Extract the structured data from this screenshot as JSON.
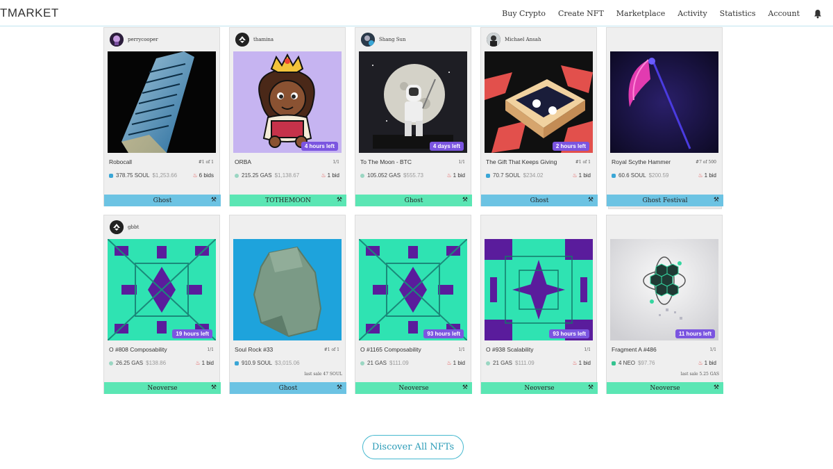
{
  "header": {
    "logo": "TMARKET",
    "nav": [
      "Buy Crypto",
      "Create NFT",
      "Marketplace",
      "Activity",
      "Statistics",
      "Account"
    ]
  },
  "colors": {
    "accent": "#45b8cf",
    "tag_ghost": "#6cc3e3",
    "tag_green": "#5be6b4",
    "badge": "#7b55e0",
    "soul": "#3aa6d6",
    "gas": "#9ad6c2",
    "neo": "#34c38f"
  },
  "cards": [
    {
      "owner": "perrycooper",
      "name": "Robocall",
      "edition": "#1 of 1",
      "price": "378.75 SOUL",
      "usd": "$1,253.66",
      "bids": "6 bids",
      "time_left": "",
      "last_sale": "",
      "tag": "Ghost",
      "currency": "soul"
    },
    {
      "owner": "thamina",
      "name": "ORBA",
      "edition": "1/1",
      "price": "215.25 GAS",
      "usd": "$1,138.67",
      "bids": "1 bid",
      "time_left": "4 hours left",
      "last_sale": "",
      "tag": "TOTHEMOON",
      "currency": "gas"
    },
    {
      "owner": "Shang Sun",
      "name": "To The Moon - BTC",
      "edition": "1/1",
      "price": "105.052 GAS",
      "usd": "$555.73",
      "bids": "1 bid",
      "time_left": "4 days left",
      "last_sale": "",
      "tag": "Ghost",
      "currency": "gas"
    },
    {
      "owner": "Michael Ansah",
      "name": "The Gift That Keeps Giving",
      "edition": "#1 of 1",
      "price": "70.7 SOUL",
      "usd": "$234.02",
      "bids": "1 bid",
      "time_left": "2 hours left",
      "last_sale": "",
      "tag": "Ghost",
      "currency": "soul"
    },
    {
      "owner": "",
      "name": "Royal Scythe Hammer",
      "edition": "#7 of 500",
      "price": "60.6 SOUL",
      "usd": "$200.59",
      "bids": "1 bid",
      "time_left": "",
      "last_sale": "",
      "tag": "Ghost Festival",
      "currency": "soul"
    },
    {
      "owner": "gbbt",
      "name": "O #808 Composability",
      "edition": "1/1",
      "price": "26.25 GAS",
      "usd": "$138.86",
      "bids": "1 bid",
      "time_left": "19 hours left",
      "last_sale": "",
      "tag": "Neoverse",
      "currency": "gas"
    },
    {
      "owner": "",
      "name": "Soul Rock #33",
      "edition": "#1 of 1",
      "price": "910.9 SOUL",
      "usd": "$3,015.06",
      "bids": "",
      "time_left": "",
      "last_sale": "last sale 47 SOUL",
      "tag": "Ghost",
      "currency": "soul"
    },
    {
      "owner": "",
      "name": "O #1165 Composability",
      "edition": "1/1",
      "price": "21 GAS",
      "usd": "$111.09",
      "bids": "1 bid",
      "time_left": "93 hours left",
      "last_sale": "",
      "tag": "Neoverse",
      "currency": "gas"
    },
    {
      "owner": "",
      "name": "O #938 Scalability",
      "edition": "1/1",
      "price": "21 GAS",
      "usd": "$111.09",
      "bids": "1 bid",
      "time_left": "93 hours left",
      "last_sale": "",
      "tag": "Neoverse",
      "currency": "gas"
    },
    {
      "owner": "",
      "name": "Fragment A #486",
      "edition": "1/1",
      "price": "4 NEO",
      "usd": "$97.76",
      "bids": "1 bid",
      "time_left": "11 hours left",
      "last_sale": "last sale 5.25 GAS",
      "tag": "Neoverse",
      "currency": "neo"
    }
  ],
  "discover_label": "Discover All NFTs"
}
